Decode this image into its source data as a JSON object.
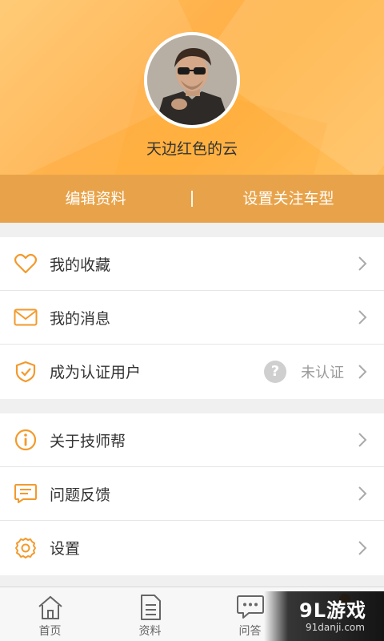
{
  "profile": {
    "username": "天边红色的云",
    "avatar_icon": "user-avatar-photo"
  },
  "actions": {
    "edit_profile": "编辑资料",
    "set_followed_models": "设置关注车型"
  },
  "menu_group_1": [
    {
      "label": "我的收藏",
      "icon": "heart-icon"
    },
    {
      "label": "我的消息",
      "icon": "envelope-icon"
    },
    {
      "label": "成为认证用户",
      "icon": "shield-check-icon",
      "status_text": "未认证",
      "status_icon": "question-mark-icon"
    }
  ],
  "menu_group_2": [
    {
      "label": "关于技师帮",
      "icon": "info-icon"
    },
    {
      "label": "问题反馈",
      "icon": "feedback-message-icon"
    },
    {
      "label": "设置",
      "icon": "gear-icon"
    }
  ],
  "tabbar": [
    {
      "label": "首页",
      "icon": "home-icon"
    },
    {
      "label": "资料",
      "icon": "document-icon"
    },
    {
      "label": "问答",
      "icon": "chat-bubble-icon"
    }
  ],
  "watermark": {
    "brand": "9L游戏",
    "domain": "91danji.com"
  },
  "colors": {
    "accent": "#f39a2b",
    "header_bar": "#e8a34a"
  }
}
